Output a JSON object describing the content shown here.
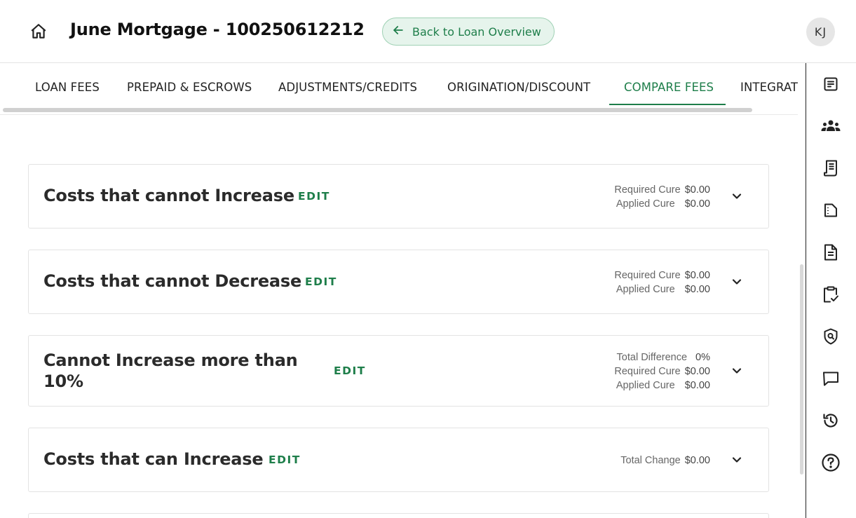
{
  "header": {
    "title": "June Mortgage - 100250612212",
    "back_label": "Back to Loan Overview",
    "avatar_initials": "KJ"
  },
  "tabs": [
    {
      "label": "LOAN FEES"
    },
    {
      "label": "PREPAID & ESCROWS"
    },
    {
      "label": "ADJUSTMENTS/CREDITS"
    },
    {
      "label": "ORIGINATION/DISCOUNT"
    },
    {
      "label": "COMPARE FEES",
      "active": true
    },
    {
      "label": "INTEGRATIONS"
    }
  ],
  "rail_icons": [
    "summary-icon",
    "people-icon",
    "receipt-icon",
    "document-outline-icon",
    "file-text-icon",
    "clipboard-check-icon",
    "shield-search-icon",
    "chat-icon",
    "history-icon",
    "help-icon"
  ],
  "cards": [
    {
      "title": "Costs that cannot Increase",
      "edit_label": "EDIT",
      "summary": [
        {
          "label": "Required Cure",
          "value": "$0.00"
        },
        {
          "label": "Applied Cure",
          "value": "$0.00"
        }
      ]
    },
    {
      "title": "Costs that cannot Decrease",
      "edit_label": "EDIT",
      "summary": [
        {
          "label": "Required Cure",
          "value": "$0.00"
        },
        {
          "label": "Applied Cure",
          "value": "$0.00"
        }
      ]
    },
    {
      "title_line1": "Cannot Increase more than",
      "title_line2": "10%",
      "edit_label": "EDIT",
      "summary": [
        {
          "label": "Total Difference",
          "value": "0%"
        },
        {
          "label": "Required Cure",
          "value": "$0.00"
        },
        {
          "label": "Applied Cure",
          "value": "$0.00"
        }
      ]
    },
    {
      "title": "Costs that can Increase",
      "edit_label": "EDIT",
      "summary": [
        {
          "label": "Total Change",
          "value": "$0.00"
        }
      ]
    }
  ],
  "colors": {
    "accent": "#1e7e4a",
    "accent_bg": "#e6f4ec",
    "border": "#e3e3e3"
  }
}
